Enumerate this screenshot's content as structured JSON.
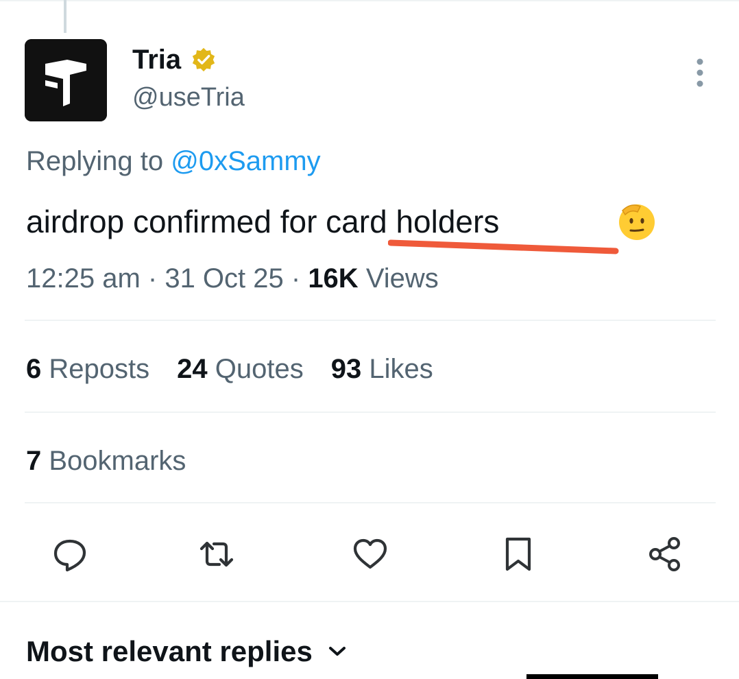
{
  "author": {
    "display_name": "Tria",
    "handle": "@useTria",
    "verified": true
  },
  "reply_context": {
    "prefix": "Replying to",
    "mention": "@0xSammy"
  },
  "tweet": {
    "text": "airdrop confirmed for card holders",
    "emoji": "saluting-face"
  },
  "meta": {
    "time": "12:25 am",
    "date": "31 Oct 25",
    "views_count": "16K",
    "views_label": "Views"
  },
  "stats": {
    "reposts_count": "6",
    "reposts_label": "Reposts",
    "quotes_count": "24",
    "quotes_label": "Quotes",
    "likes_count": "93",
    "likes_label": "Likes",
    "bookmarks_count": "7",
    "bookmarks_label": "Bookmarks"
  },
  "actions": [
    "reply-icon",
    "repost-icon",
    "like-icon",
    "bookmark-icon",
    "share-icon"
  ],
  "replies_section": {
    "heading": "Most relevant replies"
  },
  "colors": {
    "text_primary": "#0f1419",
    "text_secondary": "#536471",
    "link": "#1d9bf0",
    "verified_badge": "#e2b719",
    "annotation_underline": "#ef5a3a"
  }
}
